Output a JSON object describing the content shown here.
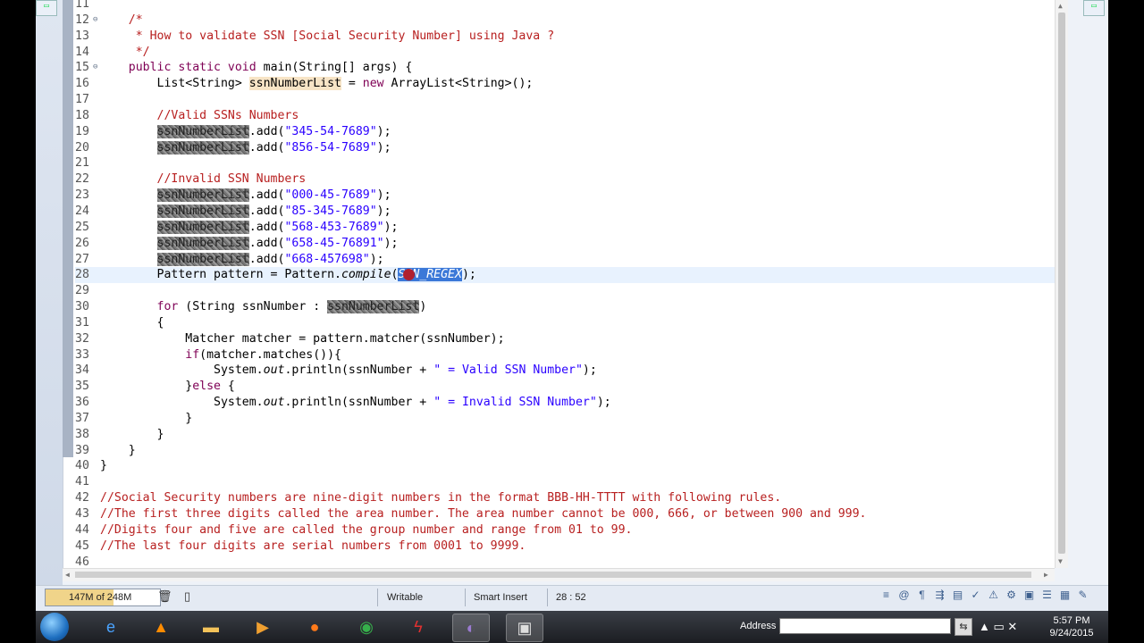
{
  "editor": {
    "lines": [
      {
        "n": "11",
        "fold": "",
        "segs": []
      },
      {
        "n": "12",
        "fold": "⊖",
        "segs": [
          {
            "t": "    /*",
            "c": "cm"
          }
        ]
      },
      {
        "n": "13",
        "fold": "",
        "segs": [
          {
            "t": "     * How to validate SSN [Social Security Number] using Java ?",
            "c": "cm"
          }
        ]
      },
      {
        "n": "14",
        "fold": "",
        "segs": [
          {
            "t": "     */",
            "c": "cm"
          }
        ]
      },
      {
        "n": "15",
        "fold": "⊖",
        "segs": [
          {
            "t": "    public static void ",
            "c": "kw"
          },
          {
            "t": "main(String[] args) {"
          }
        ]
      },
      {
        "n": "16",
        "fold": "",
        "segs": [
          {
            "t": "        List<String> "
          },
          {
            "t": "ssnNumberList",
            "c": "hl-occ"
          },
          {
            "t": " = "
          },
          {
            "t": "new",
            "c": "kw"
          },
          {
            "t": " ArrayList<String>();"
          }
        ]
      },
      {
        "n": "17",
        "fold": "",
        "segs": []
      },
      {
        "n": "18",
        "fold": "",
        "segs": [
          {
            "t": "        //Valid SSNs Numbers",
            "c": "cm"
          }
        ]
      },
      {
        "n": "19",
        "fold": "",
        "segs": [
          {
            "t": "        "
          },
          {
            "t": "ssnNumberList",
            "c": "blur"
          },
          {
            "t": ".add("
          },
          {
            "t": "\"345-54-7689\"",
            "c": "str"
          },
          {
            "t": ");"
          }
        ]
      },
      {
        "n": "20",
        "fold": "",
        "segs": [
          {
            "t": "        "
          },
          {
            "t": "ssnNumberList",
            "c": "blur"
          },
          {
            "t": ".add("
          },
          {
            "t": "\"856-54-7689\"",
            "c": "str"
          },
          {
            "t": ");"
          }
        ]
      },
      {
        "n": "21",
        "fold": "",
        "segs": []
      },
      {
        "n": "22",
        "fold": "",
        "segs": [
          {
            "t": "        //Invalid SSN Numbers",
            "c": "cm"
          }
        ]
      },
      {
        "n": "23",
        "fold": "",
        "segs": [
          {
            "t": "        "
          },
          {
            "t": "ssnNumberList",
            "c": "blur"
          },
          {
            "t": ".add("
          },
          {
            "t": "\"000-45-7689\"",
            "c": "str"
          },
          {
            "t": ");"
          }
        ]
      },
      {
        "n": "24",
        "fold": "",
        "segs": [
          {
            "t": "        "
          },
          {
            "t": "ssnNumberList",
            "c": "blur"
          },
          {
            "t": ".add("
          },
          {
            "t": "\"85-345-7689\"",
            "c": "str"
          },
          {
            "t": ");"
          }
        ]
      },
      {
        "n": "25",
        "fold": "",
        "segs": [
          {
            "t": "        "
          },
          {
            "t": "ssnNumberList",
            "c": "blur"
          },
          {
            "t": ".add("
          },
          {
            "t": "\"568-453-7689\"",
            "c": "str"
          },
          {
            "t": ");"
          }
        ]
      },
      {
        "n": "26",
        "fold": "",
        "segs": [
          {
            "t": "        "
          },
          {
            "t": "ssnNumberList",
            "c": "blur"
          },
          {
            "t": ".add("
          },
          {
            "t": "\"658-45-76891\"",
            "c": "str"
          },
          {
            "t": ");"
          }
        ]
      },
      {
        "n": "27",
        "fold": "",
        "segs": [
          {
            "t": "        "
          },
          {
            "t": "ssnNumberList",
            "c": "blur"
          },
          {
            "t": ".add("
          },
          {
            "t": "\"668-457698\"",
            "c": "str"
          },
          {
            "t": ");"
          }
        ]
      },
      {
        "n": "28",
        "fold": "",
        "current": true,
        "segs": [
          {
            "t": "        Pattern pattern = Pattern."
          },
          {
            "t": "compile",
            "c": "it"
          },
          {
            "t": "("
          },
          {
            "t": "SSN_REGEX",
            "c": "sel",
            "cursor": true
          },
          {
            "t": ");"
          }
        ]
      },
      {
        "n": "29",
        "fold": "",
        "segs": []
      },
      {
        "n": "30",
        "fold": "",
        "segs": [
          {
            "t": "        "
          },
          {
            "t": "for",
            "c": "kw"
          },
          {
            "t": " (String ssnNumber : "
          },
          {
            "t": "ssnNumberList",
            "c": "blur"
          },
          {
            "t": ")"
          }
        ]
      },
      {
        "n": "31",
        "fold": "",
        "segs": [
          {
            "t": "        {"
          }
        ]
      },
      {
        "n": "32",
        "fold": "",
        "segs": [
          {
            "t": "            Matcher matcher = pattern.matcher(ssnNumber);"
          }
        ]
      },
      {
        "n": "33",
        "fold": "",
        "segs": [
          {
            "t": "            "
          },
          {
            "t": "if",
            "c": "kw"
          },
          {
            "t": "(matcher.matches()){"
          }
        ]
      },
      {
        "n": "34",
        "fold": "",
        "segs": [
          {
            "t": "                System."
          },
          {
            "t": "out",
            "c": "it"
          },
          {
            "t": ".println(ssnNumber + "
          },
          {
            "t": "\" = Valid SSN Number\"",
            "c": "str"
          },
          {
            "t": ");"
          }
        ]
      },
      {
        "n": "35",
        "fold": "",
        "segs": [
          {
            "t": "            }"
          },
          {
            "t": "else",
            "c": "kw"
          },
          {
            "t": " {"
          }
        ]
      },
      {
        "n": "36",
        "fold": "",
        "segs": [
          {
            "t": "                System."
          },
          {
            "t": "out",
            "c": "it"
          },
          {
            "t": ".println(ssnNumber + "
          },
          {
            "t": "\" = Invalid SSN Number\"",
            "c": "str"
          },
          {
            "t": ");"
          }
        ]
      },
      {
        "n": "37",
        "fold": "",
        "segs": [
          {
            "t": "            }"
          }
        ]
      },
      {
        "n": "38",
        "fold": "",
        "segs": [
          {
            "t": "        }"
          }
        ]
      },
      {
        "n": "39",
        "fold": "",
        "segs": [
          {
            "t": "    }"
          }
        ]
      },
      {
        "n": "40",
        "fold": "",
        "segs": [
          {
            "t": "}"
          }
        ]
      },
      {
        "n": "41",
        "fold": "",
        "segs": []
      },
      {
        "n": "42",
        "fold": "",
        "segs": [
          {
            "t": "//Social Security numbers are nine-digit numbers in the format BBB-HH-TTTT with following rules.",
            "c": "cm"
          }
        ]
      },
      {
        "n": "43",
        "fold": "",
        "segs": [
          {
            "t": "//The first three digits called the area number. The area number cannot be 000, 666, or between 900 and 999.",
            "c": "cm"
          }
        ]
      },
      {
        "n": "44",
        "fold": "",
        "segs": [
          {
            "t": "//Digits four and five are called the group number and range from 01 to 99.",
            "c": "cm"
          }
        ]
      },
      {
        "n": "45",
        "fold": "",
        "segs": [
          {
            "t": "//The last four digits are serial numbers from 0001 to 9999.",
            "c": "cm"
          }
        ]
      },
      {
        "n": "46",
        "fold": "",
        "segs": []
      }
    ]
  },
  "statusbar": {
    "heap": "147M of 248M",
    "heap_fraction": 0.59,
    "writable": "Writable",
    "insert_mode": "Smart Insert",
    "position": "28 : 52"
  },
  "taskbar": {
    "address_label": "Address",
    "address_value": "",
    "time": "5:57 PM",
    "date": "9/24/2015"
  }
}
